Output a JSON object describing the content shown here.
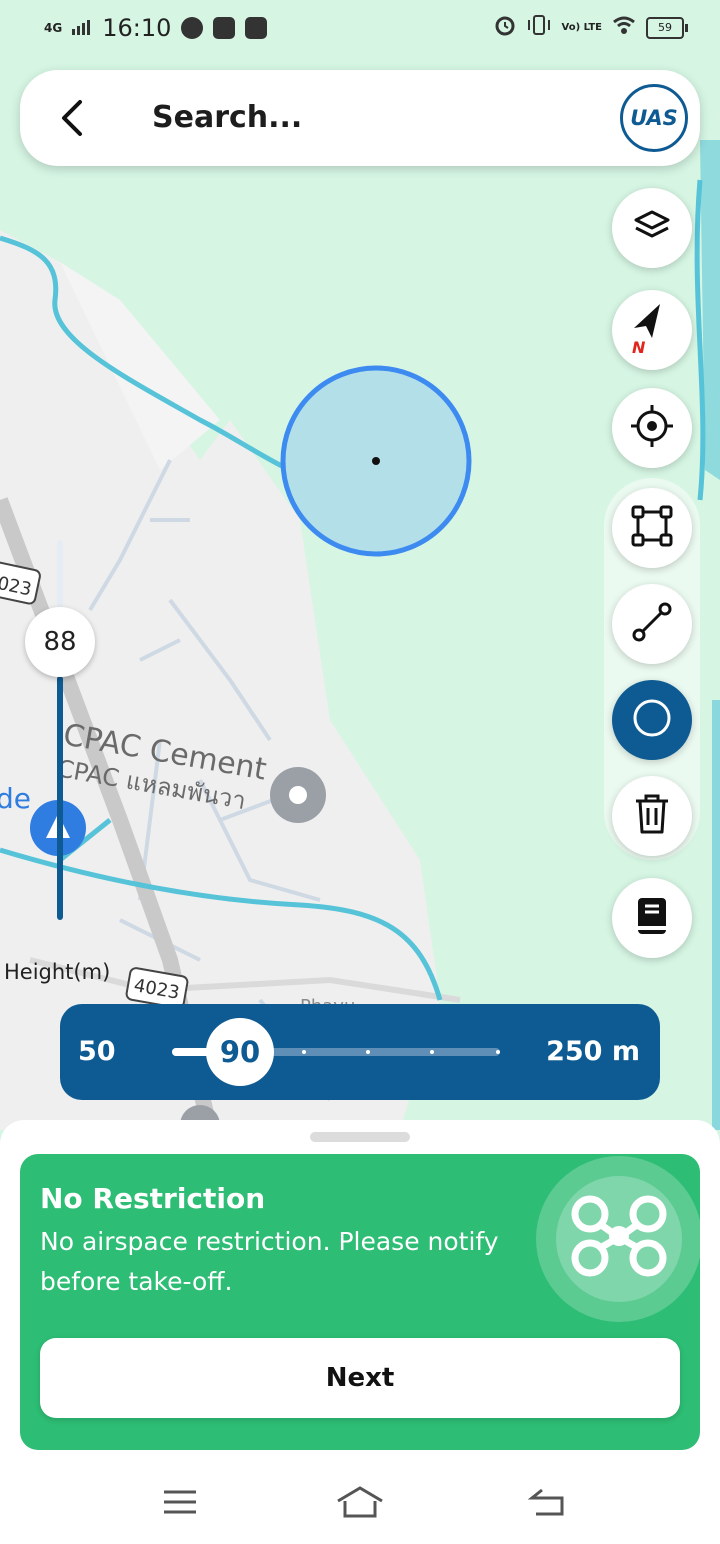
{
  "status_bar": {
    "network": "4G",
    "time": "16:10",
    "volte": "Vo) LTE",
    "battery": "59"
  },
  "search": {
    "placeholder": "Search...",
    "logo_text": "UAS"
  },
  "map_labels": {
    "place_en": "CPAC Cement",
    "place_th": "CPAC แหลมพันวา",
    "road_1": "4023",
    "road_2": "4023",
    "road_3": "023",
    "side_text": "de",
    "road_name_partial": "Phayu"
  },
  "compass": {
    "north_label": "N"
  },
  "height_slider": {
    "value": "88",
    "label": "Height(m)",
    "fraction": 0.36
  },
  "radius_slider": {
    "min_label": "50",
    "max_label": "250 m",
    "value": "90",
    "fraction": 0.2
  },
  "status_card": {
    "title": "No Restriction",
    "description": "No airspace restriction. Please notify before take-off.",
    "next_label": "Next"
  },
  "colors": {
    "primary": "#0e5b93",
    "success": "#2dbd74",
    "map_green": "#d6f5e3",
    "water": "#56c3d8",
    "circle_stroke": "#3d8bf0"
  },
  "icons": [
    "back-arrow-icon",
    "layers-icon",
    "compass-icon",
    "my-location-icon",
    "polygon-icon",
    "line-icon",
    "circle-icon",
    "trash-icon",
    "book-icon",
    "drone-icon",
    "menu-icon",
    "home-icon",
    "back-icon"
  ]
}
